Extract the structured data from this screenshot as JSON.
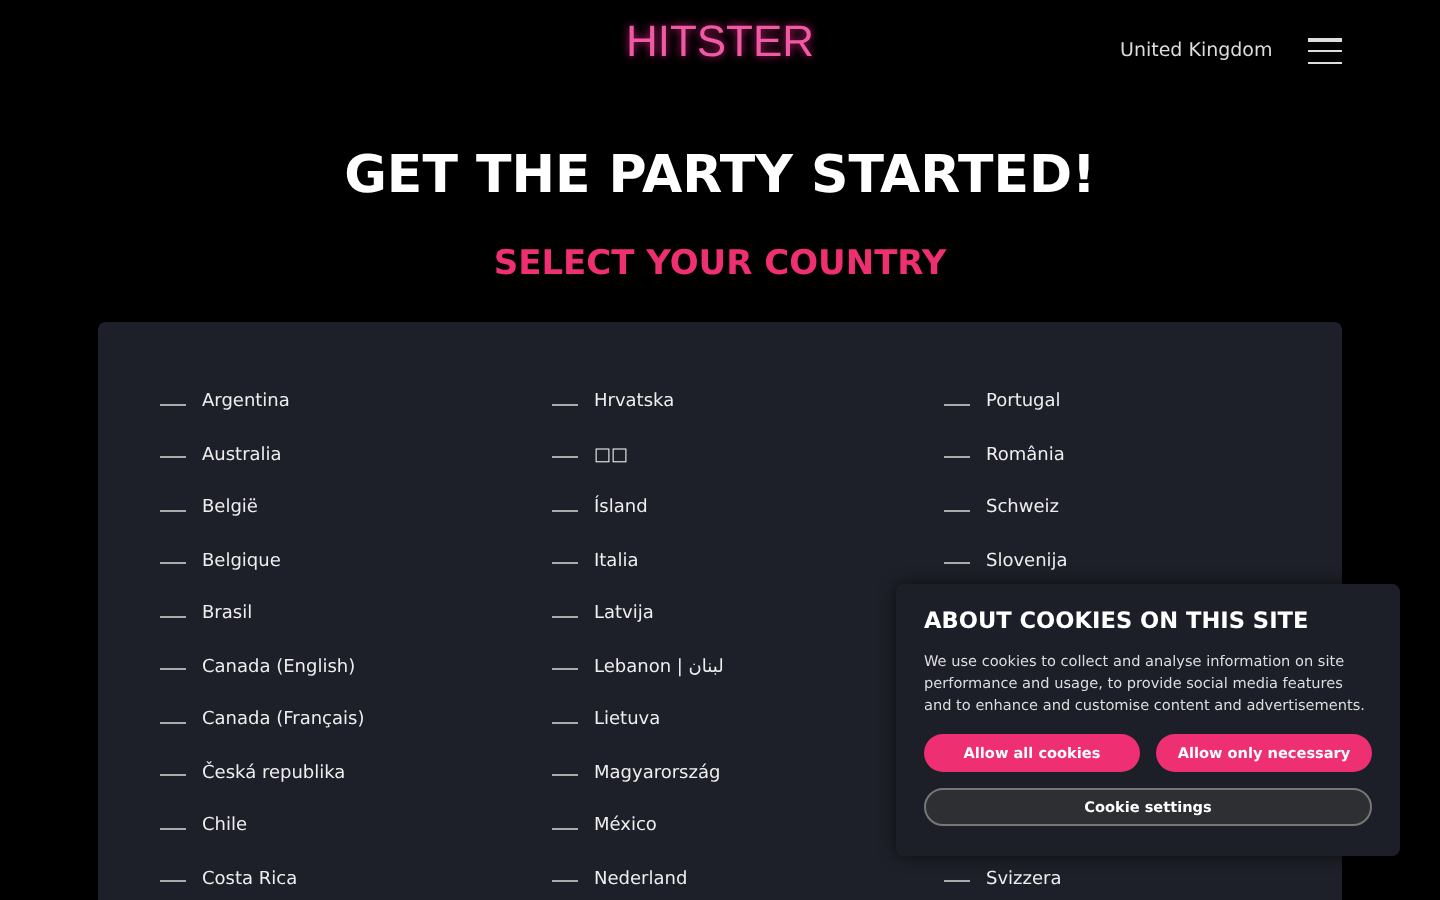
{
  "header": {
    "logo": "HITSTER",
    "region": "United Kingdom"
  },
  "title": "GET THE PARTY STARTED!",
  "subtitle": "SELECT YOUR COUNTRY",
  "country_rows": [
    [
      "Argentina",
      "Hrvatska",
      "Portugal"
    ],
    [
      "Australia",
      "□□",
      "România"
    ],
    [
      "België",
      "Ísland",
      "Schweiz"
    ],
    [
      "Belgique",
      "Italia",
      "Slovenija"
    ],
    [
      "Brasil",
      "Latvija"
    ],
    [
      "Canada (English)",
      "Lebanon | لبنان"
    ],
    [
      "Canada (Français)",
      "Lietuva"
    ],
    [
      "Česká republika",
      "Magyarország"
    ],
    [
      "Chile",
      "México"
    ],
    [
      "Costa Rica",
      "Nederland",
      "Svizzera"
    ]
  ],
  "cookie_banner": {
    "title": "ABOUT COOKIES ON THIS SITE",
    "text": "We use cookies to collect and analyse information on site performance and usage, to provide social media features and to enhance and customise content and advertisements.",
    "buttons": [
      {
        "label": "Allow all cookies",
        "kind": "primary"
      },
      {
        "label": "Allow only necessary",
        "kind": "primary"
      },
      {
        "label": "Cookie settings",
        "kind": "secondary"
      }
    ]
  }
}
